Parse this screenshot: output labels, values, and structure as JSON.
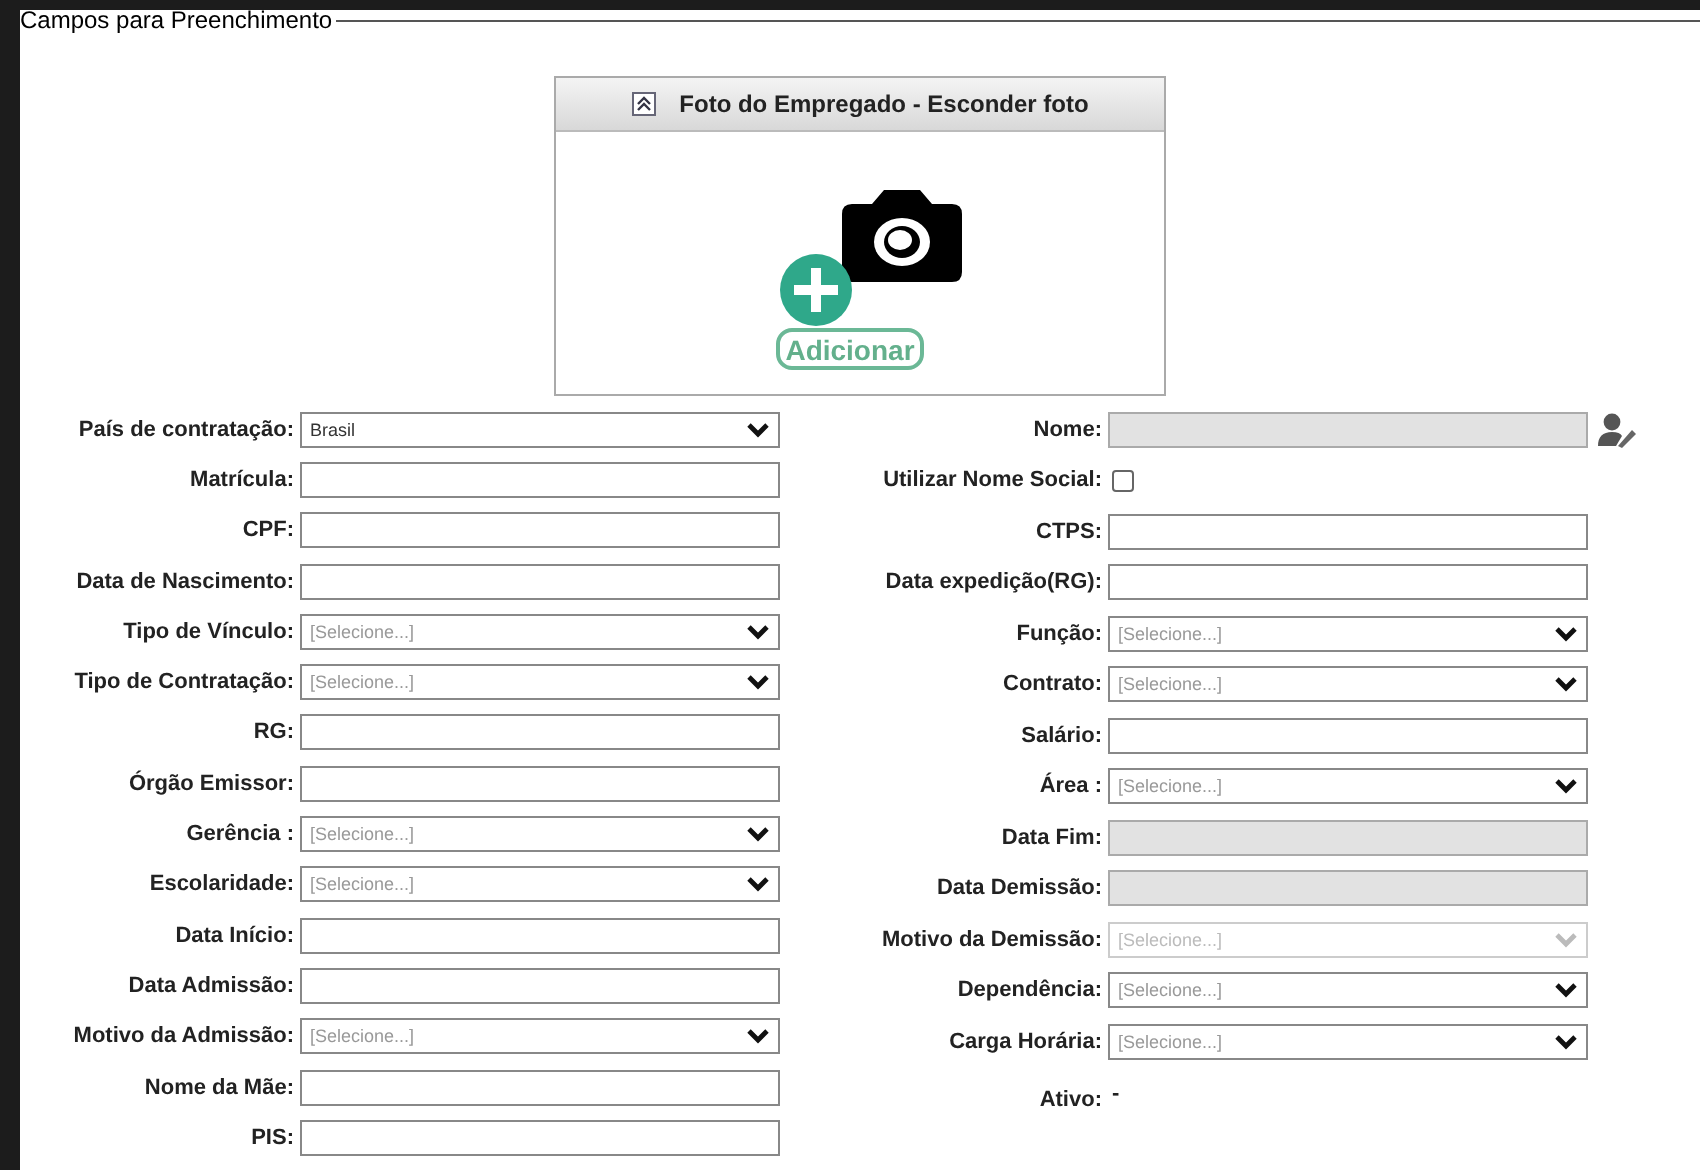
{
  "legend": "Campos para Preenchimento",
  "photo_panel": {
    "title": "Foto do Empregado - Esconder foto",
    "add_button": "Adicionar"
  },
  "left_fields": [
    {
      "label": "País de contratação:",
      "kind": "select",
      "value": "Brasil",
      "disabled": false
    },
    {
      "label": "Matrícula:",
      "kind": "text",
      "disabled": false
    },
    {
      "label": "CPF:",
      "kind": "text",
      "disabled": false
    },
    {
      "label": "Data de Nascimento:",
      "kind": "text",
      "disabled": false
    },
    {
      "label": "Tipo de Vínculo:",
      "kind": "select",
      "placeholder": "[Selecione...]",
      "disabled": false
    },
    {
      "label": "Tipo de Contratação:",
      "kind": "select",
      "placeholder": "[Selecione...]",
      "disabled": false
    },
    {
      "label": "RG:",
      "kind": "text",
      "disabled": false
    },
    {
      "label": "Órgão Emissor:",
      "kind": "text",
      "disabled": false
    },
    {
      "label": "Gerência :",
      "kind": "select",
      "placeholder": "[Selecione...]",
      "disabled": false
    },
    {
      "label": "Escolaridade:",
      "kind": "select",
      "placeholder": "[Selecione...]",
      "disabled": false
    },
    {
      "label": "Data Início:",
      "kind": "text",
      "disabled": false
    },
    {
      "label": "Data Admissão:",
      "kind": "text",
      "disabled": false
    },
    {
      "label": "Motivo da Admissão:",
      "kind": "select",
      "placeholder": "[Selecione...]",
      "disabled": false
    },
    {
      "label": "Nome da Mãe:",
      "kind": "text",
      "disabled": false
    },
    {
      "label": "PIS:",
      "kind": "text",
      "disabled": false
    }
  ],
  "right_fields": [
    {
      "label": "Nome:",
      "kind": "text",
      "disabled": true,
      "has_user_icon": true
    },
    {
      "label": "Utilizar Nome Social:",
      "kind": "checkbox",
      "checked": false
    },
    {
      "label": "CTPS:",
      "kind": "text",
      "disabled": false
    },
    {
      "label": "Data expedição(RG):",
      "kind": "text",
      "disabled": false
    },
    {
      "label": "Função:",
      "kind": "select",
      "placeholder": "[Selecione...]",
      "disabled": false
    },
    {
      "label": "Contrato:",
      "kind": "select",
      "placeholder": "[Selecione...]",
      "disabled": false
    },
    {
      "label": "Salário:",
      "kind": "text",
      "disabled": false
    },
    {
      "label": "Área :",
      "kind": "select",
      "placeholder": "[Selecione...]",
      "disabled": false
    },
    {
      "label": "Data Fim:",
      "kind": "text",
      "disabled": true
    },
    {
      "label": "Data Demissão:",
      "kind": "text",
      "disabled": true
    },
    {
      "label": "Motivo da Demissão:",
      "kind": "select",
      "placeholder": "[Selecione...]",
      "disabled": true
    },
    {
      "label": "Dependência:",
      "kind": "select",
      "placeholder": "[Selecione...]",
      "disabled": false
    },
    {
      "label": "Carga Horária:",
      "kind": "select",
      "placeholder": "[Selecione...]",
      "disabled": false
    },
    {
      "label": "Ativo:",
      "kind": "static",
      "value": "-"
    }
  ]
}
